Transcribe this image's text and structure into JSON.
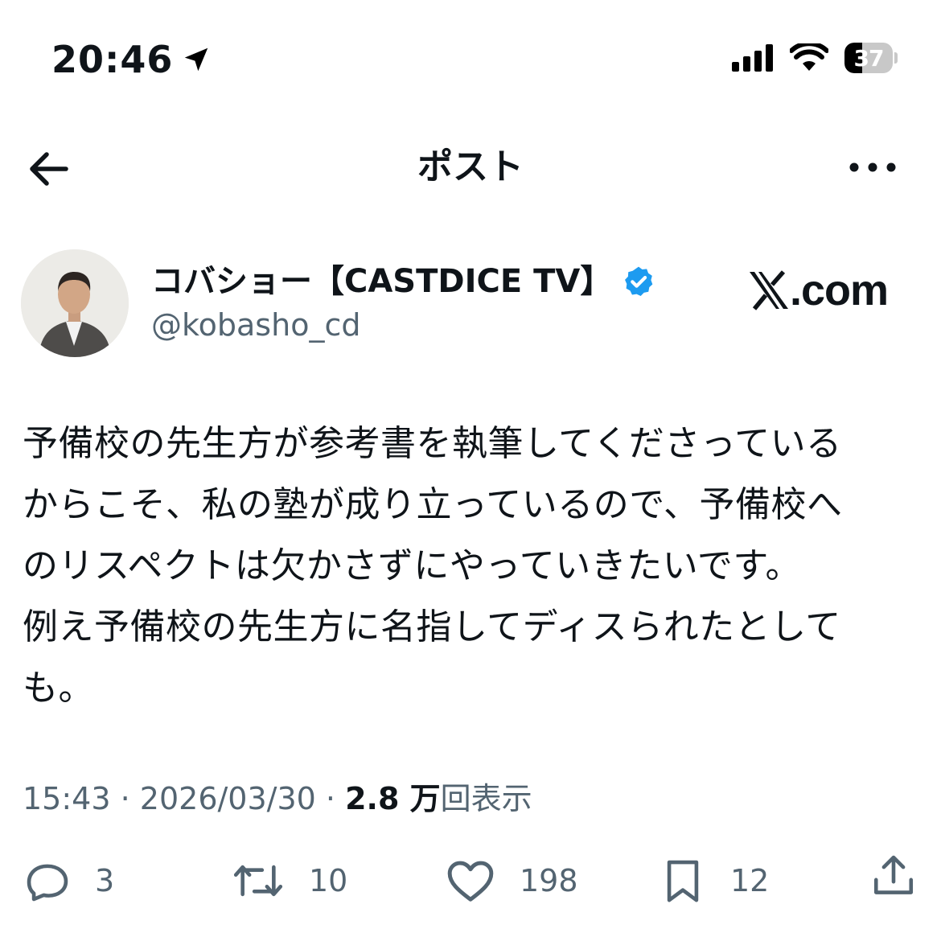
{
  "status_bar": {
    "time": "20:46",
    "battery_level": "37",
    "battery_fraction": 0.37
  },
  "nav": {
    "title": "ポスト"
  },
  "author": {
    "name": "コバショー【CASTDICE TV】",
    "handle": "@kobasho_cd",
    "verified": true
  },
  "brand": {
    "site": ".com"
  },
  "post": {
    "lines": [
      "予備校の先生方が参考書を執筆してくださっている",
      "からこそ、私の塾が成り立っているので、予備校へ",
      "のリスペクトは欠かさずにやっていきたいです。",
      "例え予備校の先生方に名指してディスられたとして",
      "も。"
    ]
  },
  "meta": {
    "time": "15:43",
    "separator": "·",
    "date": "2026/03/30",
    "views_count": "2.8 万",
    "views_label": "回表示"
  },
  "actions": {
    "replies": "3",
    "reposts": "10",
    "likes": "198",
    "bookmarks": "12"
  },
  "colors": {
    "text": "#0f1419",
    "secondary": "#536471",
    "verified": "#1d9bf0"
  }
}
